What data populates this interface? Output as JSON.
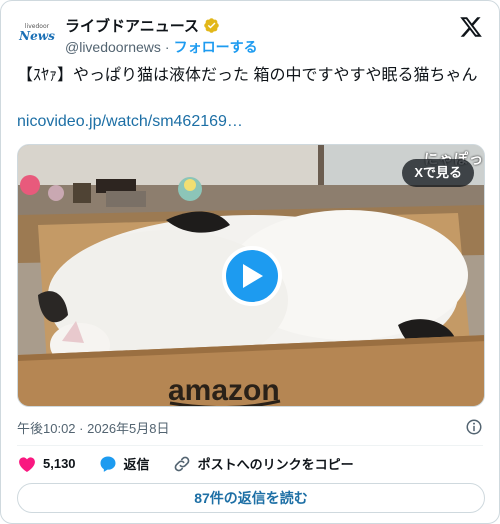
{
  "account": {
    "avatar_small": "livedoor",
    "avatar_big": "News",
    "display_name": "ライブドアニュース",
    "handle": "@livedoornews",
    "separator": "·",
    "follow_label": "フォローする"
  },
  "tweet": {
    "text": "【ｽﾔｧ】やっぱり猫は液体だった 箱の中ですやすや眠る猫ちゃん",
    "link": "nicovideo.jp/watch/sm462169…"
  },
  "media": {
    "view_on_x_label": "Xで見る",
    "overlay_caption": "にゃぽっ",
    "box_brand": "amazon"
  },
  "meta": {
    "time": "午後10:02",
    "separator": "·",
    "date": "2026年5月8日"
  },
  "actions": {
    "likes": "5,130",
    "reply_label": "返信",
    "copy_link_label": "ポストへのリンクをコピー"
  },
  "read_replies_label": "87件の返信を読む",
  "colors": {
    "accent": "#1d9bf0",
    "link": "#1d6fa5",
    "like": "#f91880",
    "muted": "#536471"
  }
}
